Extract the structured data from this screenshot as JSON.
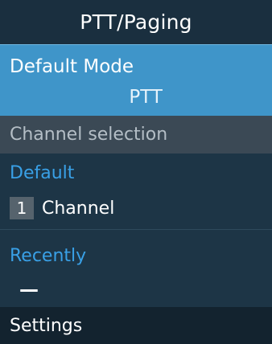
{
  "header": {
    "title": "PTT/Paging"
  },
  "mode": {
    "label": "Default Mode",
    "value": "PTT"
  },
  "channel_section": {
    "header": "Channel selection",
    "default": {
      "label": "Default",
      "channel_number": "1",
      "channel_name": "Channel"
    },
    "recently": {
      "label": "Recently",
      "value": "—"
    }
  },
  "softkeys": {
    "left": "Settings"
  },
  "colors": {
    "background": "#1b2f3f",
    "selected": "#3f95c9",
    "accent": "#39a0e6",
    "section_header": "#3b4955"
  }
}
